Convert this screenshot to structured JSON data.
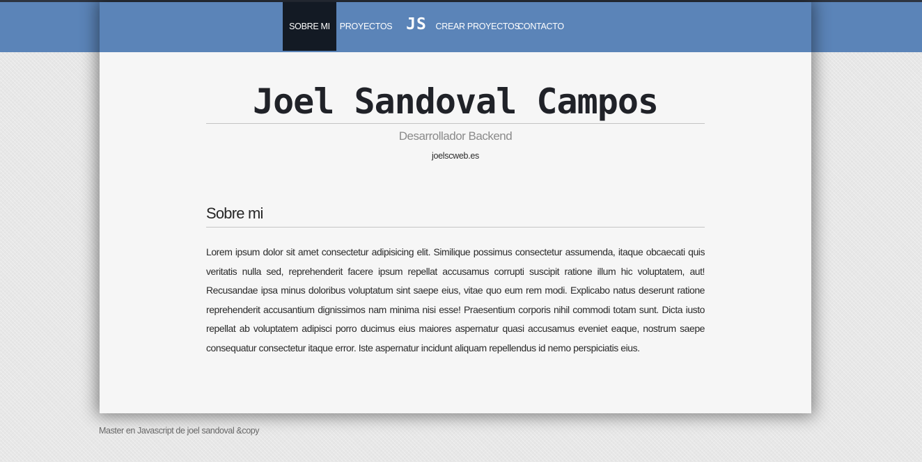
{
  "nav": {
    "items": [
      {
        "label": "Sobre mi",
        "active": true
      },
      {
        "label": "Proyectos",
        "active": false
      },
      {
        "label": "Crear proyectos",
        "active": false
      },
      {
        "label": "Contacto",
        "active": false
      }
    ],
    "logo": "JS"
  },
  "header": {
    "name": "Joel Sandoval Campos",
    "subtitle": "Desarrollador Backend",
    "website": "joelscweb.es"
  },
  "about": {
    "title": "Sobre mi",
    "body": "Lorem ipsum dolor sit amet consectetur adipisicing elit. Similique possimus consectetur assumenda, itaque obcaecati quis veritatis nulla sed, reprehenderit facere ipsum repellat accusamus corrupti suscipit ratione illum hic voluptatem, aut! Recusandae ipsa minus doloribus voluptatum sint saepe eius, vitae quo eum rem modi. Explicabo natus deserunt ratione reprehenderit accusantium dignissimos nam minima nisi esse! Praesentium corporis nihil commodi totam sunt. Dicta iusto repellat ab voluptatem adipisci porro ducimus eius maiores aspernatur quasi accusamus eveniet eaque, nostrum saepe consequatur consectetur itaque error. Iste aspernatur incidunt aliquam repellendus id nemo perspiciatis eius."
  },
  "footer": {
    "text": "Master en Javascript de joel sandoval &copy"
  },
  "colors": {
    "header_blue": "#5b84b8",
    "nav_active": "#131a24",
    "page_bg": "#f6f6f6"
  }
}
